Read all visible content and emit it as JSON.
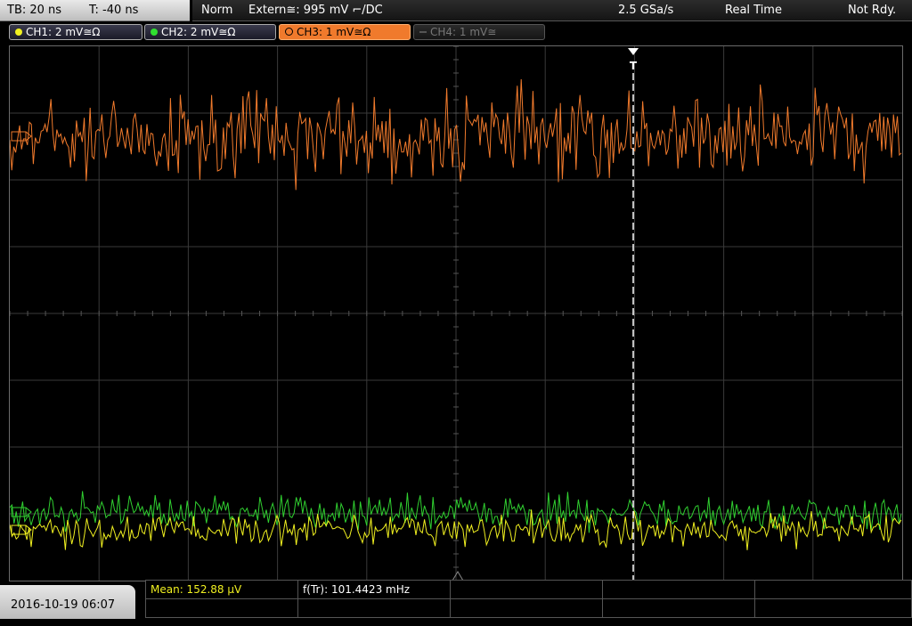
{
  "status_bar": {
    "timebase": "TB: 20 ns",
    "trigger_time": "T: -40 ns",
    "trigger_mode": "Norm",
    "trigger_source": "Extern≅: 995 mV ⌐/DC",
    "sample_rate": "2.5 GSa/s",
    "acq_mode": "Real Time",
    "state": "Not Rdy."
  },
  "channels": [
    {
      "label": "CH1: 2 mV≅Ω",
      "color": "#f0f020",
      "state": "on"
    },
    {
      "label": "CH2: 2 mV≅Ω",
      "color": "#30e030",
      "state": "on"
    },
    {
      "label": "CH3: 1 mV≅Ω",
      "color": "#f07a2c",
      "state": "active"
    },
    {
      "label": "CH4: 1 mV≅",
      "color": "#666666",
      "state": "off"
    }
  ],
  "trigger_marker": "T",
  "date_time": "2016-10-19 06:07",
  "measurements": {
    "mean": "Mean: 152.88 µV",
    "frequency": "f(Tr): 101.4423 mHz"
  },
  "colors": {
    "ch1": "#f0f020",
    "ch2": "#30d030",
    "ch3": "#f07a2c",
    "grid": "#3a3a3a",
    "background": "#000000"
  }
}
